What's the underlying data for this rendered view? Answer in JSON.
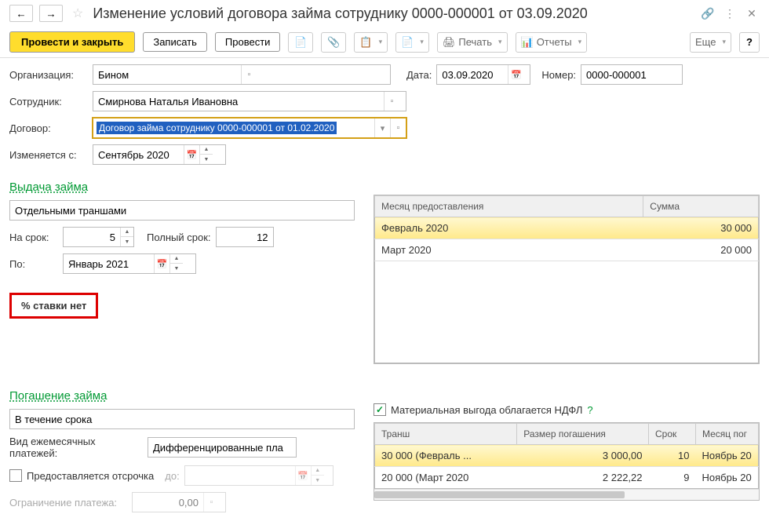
{
  "title": "Изменение условий договора займа сотруднику 0000-000001 от 03.09.2020",
  "toolbar": {
    "submit_close": "Провести и закрыть",
    "record": "Записать",
    "submit": "Провести",
    "print": "Печать",
    "reports": "Отчеты",
    "more": "Еще"
  },
  "fields": {
    "org_label": "Организация:",
    "org_value": "Бином",
    "date_label": "Дата:",
    "date_value": "03.09.2020",
    "num_label": "Номер:",
    "num_value": "0000-000001",
    "emp_label": "Сотрудник:",
    "emp_value": "Смирнова Наталья Ивановна",
    "contract_label": "Договор:",
    "contract_value": "Договор займа сотруднику 0000-000001 от 01.02.2020",
    "from_label": "Изменяется с:",
    "from_value": "Сентябрь 2020"
  },
  "loan_section": {
    "title": "Выдача займа",
    "method": "Отдельными траншами",
    "term_label": "На срок:",
    "term_value": "5",
    "full_term_label": "Полный срок:",
    "full_term_value": "12",
    "until_label": "По:",
    "until_value": "Январь 2021",
    "rate_box": "% ставки нет"
  },
  "tranche_table": {
    "col_month": "Месяц предоставления",
    "col_sum": "Сумма",
    "rows": [
      {
        "month": "Февраль 2020",
        "sum": "30 000"
      },
      {
        "month": "Март 2020",
        "sum": "20 000"
      }
    ]
  },
  "repay_section": {
    "title": "Погашение займа",
    "method": "В течение срока",
    "pay_type_label": "Вид ежемесячных платежей:",
    "pay_type_value": "Дифференцированные пла",
    "deferment_label": "Предоставляется отсрочка",
    "deferment_until": "до:",
    "limit_label": "Ограничение платежа:",
    "limit_value": "0,00",
    "ndfl_checkbox": "Материальная выгода облагается НДФЛ"
  },
  "repay_table": {
    "col_tranche": "Транш",
    "col_amount": "Размер погашения",
    "col_term": "Срок",
    "col_month": "Месяц пог",
    "rows": [
      {
        "tranche": "30 000  (Февраль ...",
        "amount": "3 000,00",
        "term": "10",
        "month": "Ноябрь 20"
      },
      {
        "tranche": "20 000  (Март 2020",
        "amount": "2 222,22",
        "term": "9",
        "month": "Ноябрь 20"
      }
    ]
  }
}
